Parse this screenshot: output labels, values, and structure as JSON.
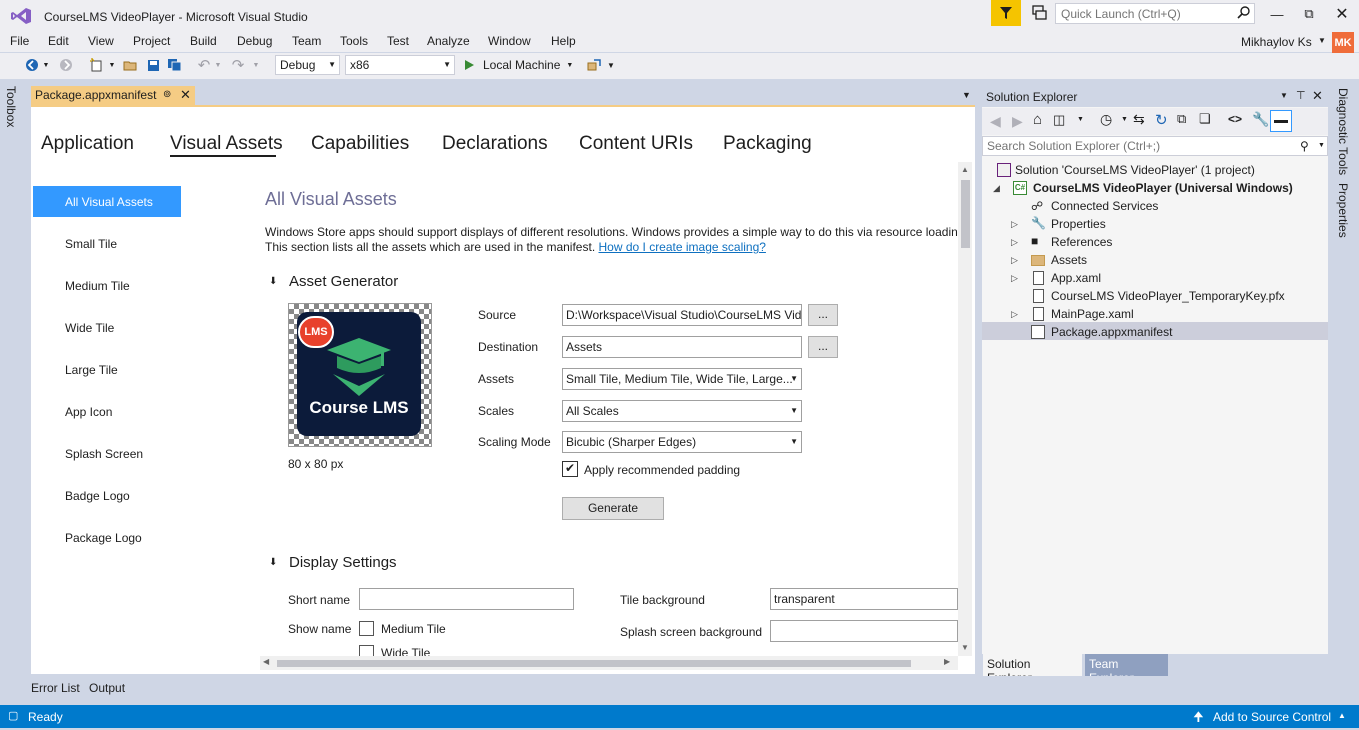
{
  "window": {
    "title": "CourseLMS VideoPlayer - Microsoft Visual Studio",
    "quick_launch_placeholder": "Quick Launch (Ctrl+Q)",
    "min_icon": "minimize-icon",
    "max_icon": "maximize-icon",
    "close_icon": "close-icon"
  },
  "menu": [
    "File",
    "Edit",
    "View",
    "Project",
    "Build",
    "Debug",
    "Team",
    "Tools",
    "Test",
    "Analyze",
    "Window",
    "Help"
  ],
  "user": {
    "name": "Mikhaylov Ks",
    "initials": "MK"
  },
  "toolbar": {
    "config": "Debug",
    "platform": "x86",
    "run_target": "Local Machine"
  },
  "toolbox_label": "Toolbox",
  "doc_tab": {
    "title": "Package.appxmanifest"
  },
  "manifest_tabs": [
    "Application",
    "Visual Assets",
    "Capabilities",
    "Declarations",
    "Content URIs",
    "Packaging"
  ],
  "manifest_active_tab": "Visual Assets",
  "left_nav": [
    "All Visual Assets",
    "Small Tile",
    "Medium Tile",
    "Wide Tile",
    "Large Tile",
    "App Icon",
    "Splash Screen",
    "Badge Logo",
    "Package Logo"
  ],
  "section_title": "All Visual Assets",
  "description_line1": "Windows Store apps should support displays of different resolutions. Windows provides a simple way to do this via resource loading",
  "description_line2": "This section lists all the assets which are used in the manifest.",
  "description_link": "How do I create image scaling?",
  "asset_generator": {
    "heading": "Asset Generator",
    "preview_badge": "LMS",
    "preview_text": "Course LMS",
    "preview_size": "80 x 80 px",
    "source_label": "Source",
    "source_value": "D:\\Workspace\\Visual Studio\\CourseLMS Video",
    "destination_label": "Destination",
    "destination_value": "Assets",
    "assets_label": "Assets",
    "assets_value": "Small Tile, Medium Tile, Wide Tile, Large...",
    "scales_label": "Scales",
    "scales_value": "All Scales",
    "scaling_mode_label": "Scaling Mode",
    "scaling_mode_value": "Bicubic (Sharper Edges)",
    "browse_label": "...",
    "padding_label": "Apply recommended padding",
    "padding_checked": true,
    "generate_label": "Generate"
  },
  "display_settings": {
    "heading": "Display Settings",
    "short_name_label": "Short name",
    "short_name_value": "",
    "show_name_label": "Show name",
    "medium_tile_label": "Medium Tile",
    "wide_tile_label": "Wide Tile",
    "tile_background_label": "Tile background",
    "tile_background_value": "transparent",
    "splash_background_label": "Splash screen background",
    "splash_background_value": ""
  },
  "solution_explorer": {
    "title": "Solution Explorer",
    "search_placeholder": "Search Solution Explorer (Ctrl+;)",
    "items": [
      {
        "label": "Solution 'CourseLMS VideoPlayer' (1 project)",
        "icon": "solution-icon"
      },
      {
        "label": "CourseLMS VideoPlayer (Universal Windows)",
        "icon": "csharp-project-icon"
      },
      {
        "label": "Connected Services",
        "icon": "connected-services-icon"
      },
      {
        "label": "Properties",
        "icon": "wrench-icon"
      },
      {
        "label": "References",
        "icon": "references-icon"
      },
      {
        "label": "Assets",
        "icon": "folder-icon"
      },
      {
        "label": "App.xaml",
        "icon": "xaml-file-icon"
      },
      {
        "label": "CourseLMS VideoPlayer_TemporaryKey.pfx",
        "icon": "key-file-icon"
      },
      {
        "label": "MainPage.xaml",
        "icon": "xaml-file-icon"
      },
      {
        "label": "Package.appxmanifest",
        "icon": "manifest-file-icon"
      }
    ],
    "tab_solution": "Solution Explorer",
    "tab_team": "Team Explorer"
  },
  "right_strip": {
    "diagnostic": "Diagnostic Tools",
    "properties": "Properties"
  },
  "bottom_tabs": [
    "Error List",
    "Output"
  ],
  "status": {
    "ready": "Ready",
    "source_control": "Add to Source Control"
  },
  "colors": {
    "accent": "#007acc",
    "selection": "#3399ff",
    "tab_active": "#f5cc84",
    "filter": "#f5c400"
  }
}
